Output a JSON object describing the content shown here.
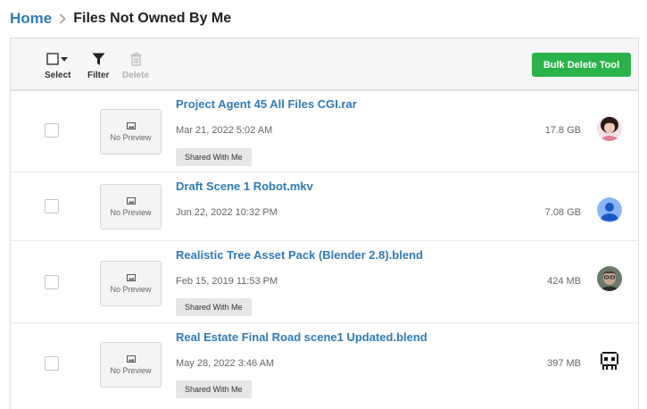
{
  "breadcrumb": {
    "home": "Home",
    "separator_icon": "chevron-right-icon",
    "current": "Files Not Owned By Me"
  },
  "toolbar": {
    "select_label": "Select",
    "filter_label": "Filter",
    "delete_label": "Delete",
    "bulk_delete_label": "Bulk Delete Tool"
  },
  "files": [
    {
      "name": "Project Agent 45 All Files CGI.rar",
      "date": "Mar 21, 2022 5:02 AM",
      "size": "17.8 GB",
      "preview": "No Preview",
      "tag": "Shared With Me",
      "avatar": "woman-photo-avatar"
    },
    {
      "name": "Draft Scene 1 Robot.mkv",
      "date": "Jun 22, 2022 10:32 PM",
      "size": "7.08 GB",
      "preview": "No Preview",
      "avatar": "default-user-avatar"
    },
    {
      "name": "Realistic Tree Asset Pack (Blender 2.8).blend",
      "date": "Feb 15, 2019 11:53 PM",
      "size": "424 MB",
      "preview": "No Preview",
      "tag": "Shared With Me",
      "avatar": "man-photo-avatar"
    },
    {
      "name": "Real Estate Final Road scene1 Updated.blend",
      "date": "May 28, 2022 3:46 AM",
      "size": "397 MB",
      "preview": "No Preview",
      "tag": "Shared With Me",
      "avatar": "pixel-robot-avatar"
    }
  ],
  "colors": {
    "link": "#2f7bb8",
    "accent_button": "#29b34a",
    "toolbar_bg": "#f7f7f7"
  }
}
